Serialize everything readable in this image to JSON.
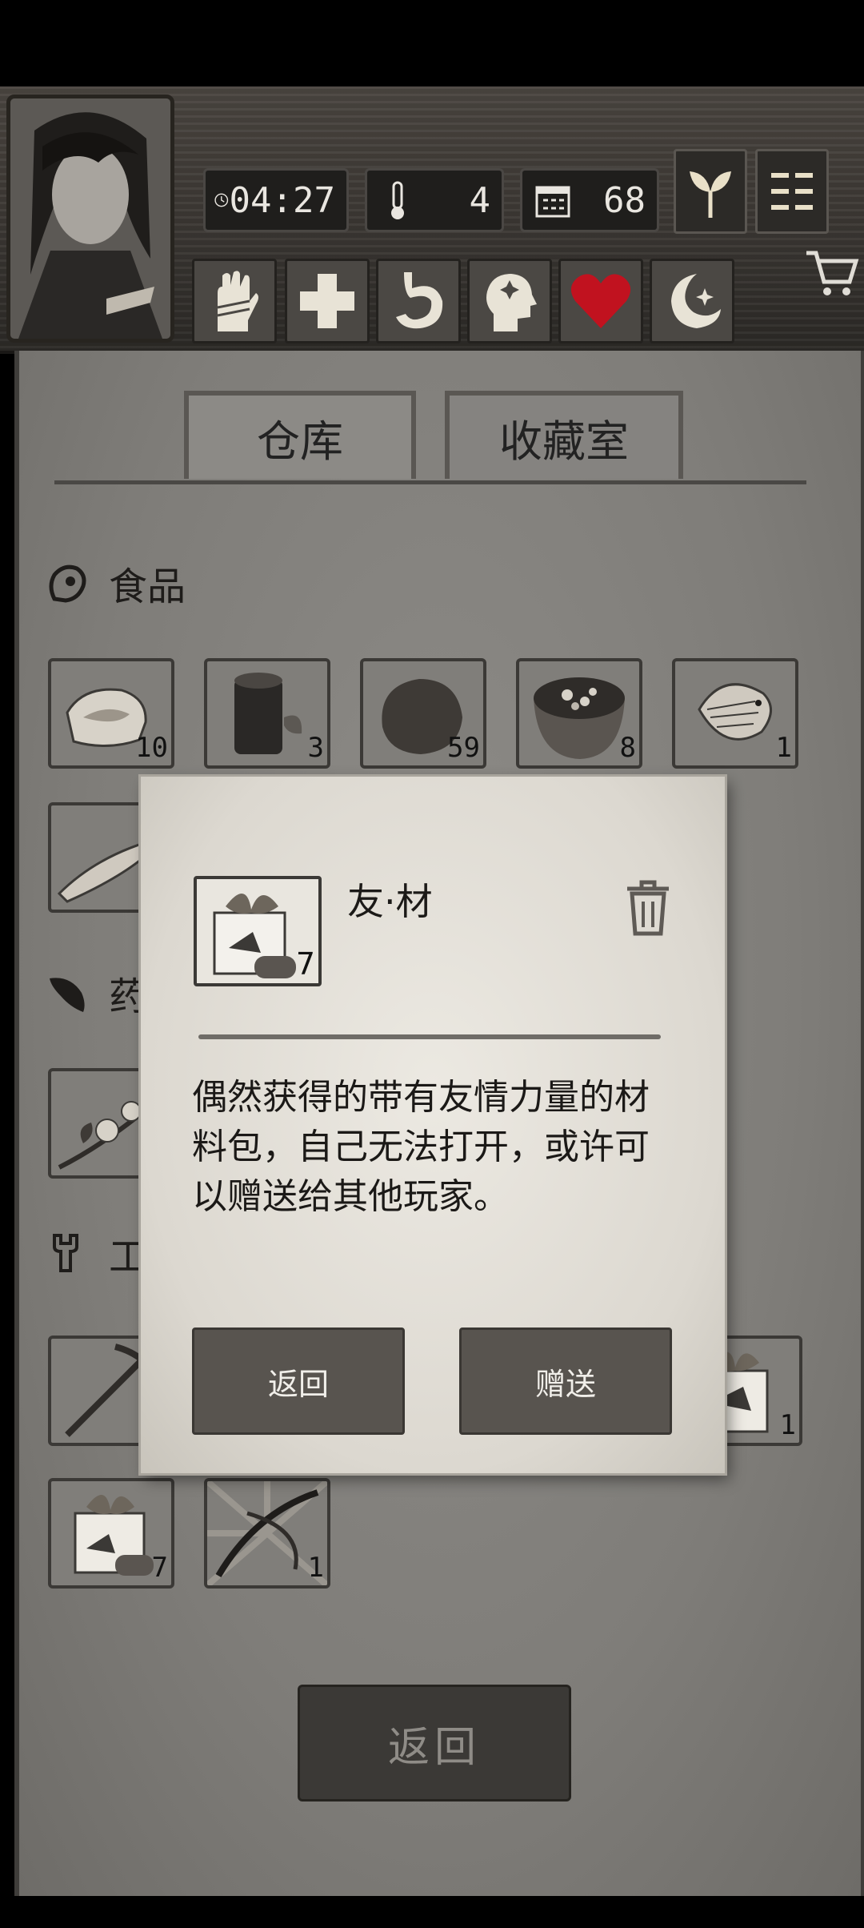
{
  "stats": {
    "time": "04:27",
    "temperature": "4",
    "day": "68"
  },
  "tabs": [
    {
      "label": "仓库",
      "active": true
    },
    {
      "label": "收藏室",
      "active": false
    }
  ],
  "sections": {
    "food": "食品",
    "medicine": "药",
    "tools": "工"
  },
  "food_items": [
    {
      "icon": "meat-icon",
      "count": "10"
    },
    {
      "icon": "log-icon",
      "count": "3"
    },
    {
      "icon": "potato-icon",
      "count": "59"
    },
    {
      "icon": "soup-bowl-icon",
      "count": "8"
    },
    {
      "icon": "fish-icon",
      "count": "1"
    }
  ],
  "tool_items": [
    {
      "icon": "gift-box-icon",
      "count": "1"
    },
    {
      "icon": "gift-box-icon",
      "count": "7"
    },
    {
      "icon": "crossbow-icon",
      "count": "1"
    }
  ],
  "dialog": {
    "item_icon": "gift-box-icon",
    "item_count": "7",
    "title": "友·材",
    "description": "偶然获得的带有友情力量的材料包，自己无法打开，或许可以赠送给其他玩家。",
    "back_label": "返回",
    "gift_label": "赠送"
  },
  "bottom_button": "返回",
  "colors": {
    "heart": "#c1121f",
    "parchment": "#7f7d79",
    "dialog": "#e6e2da"
  }
}
